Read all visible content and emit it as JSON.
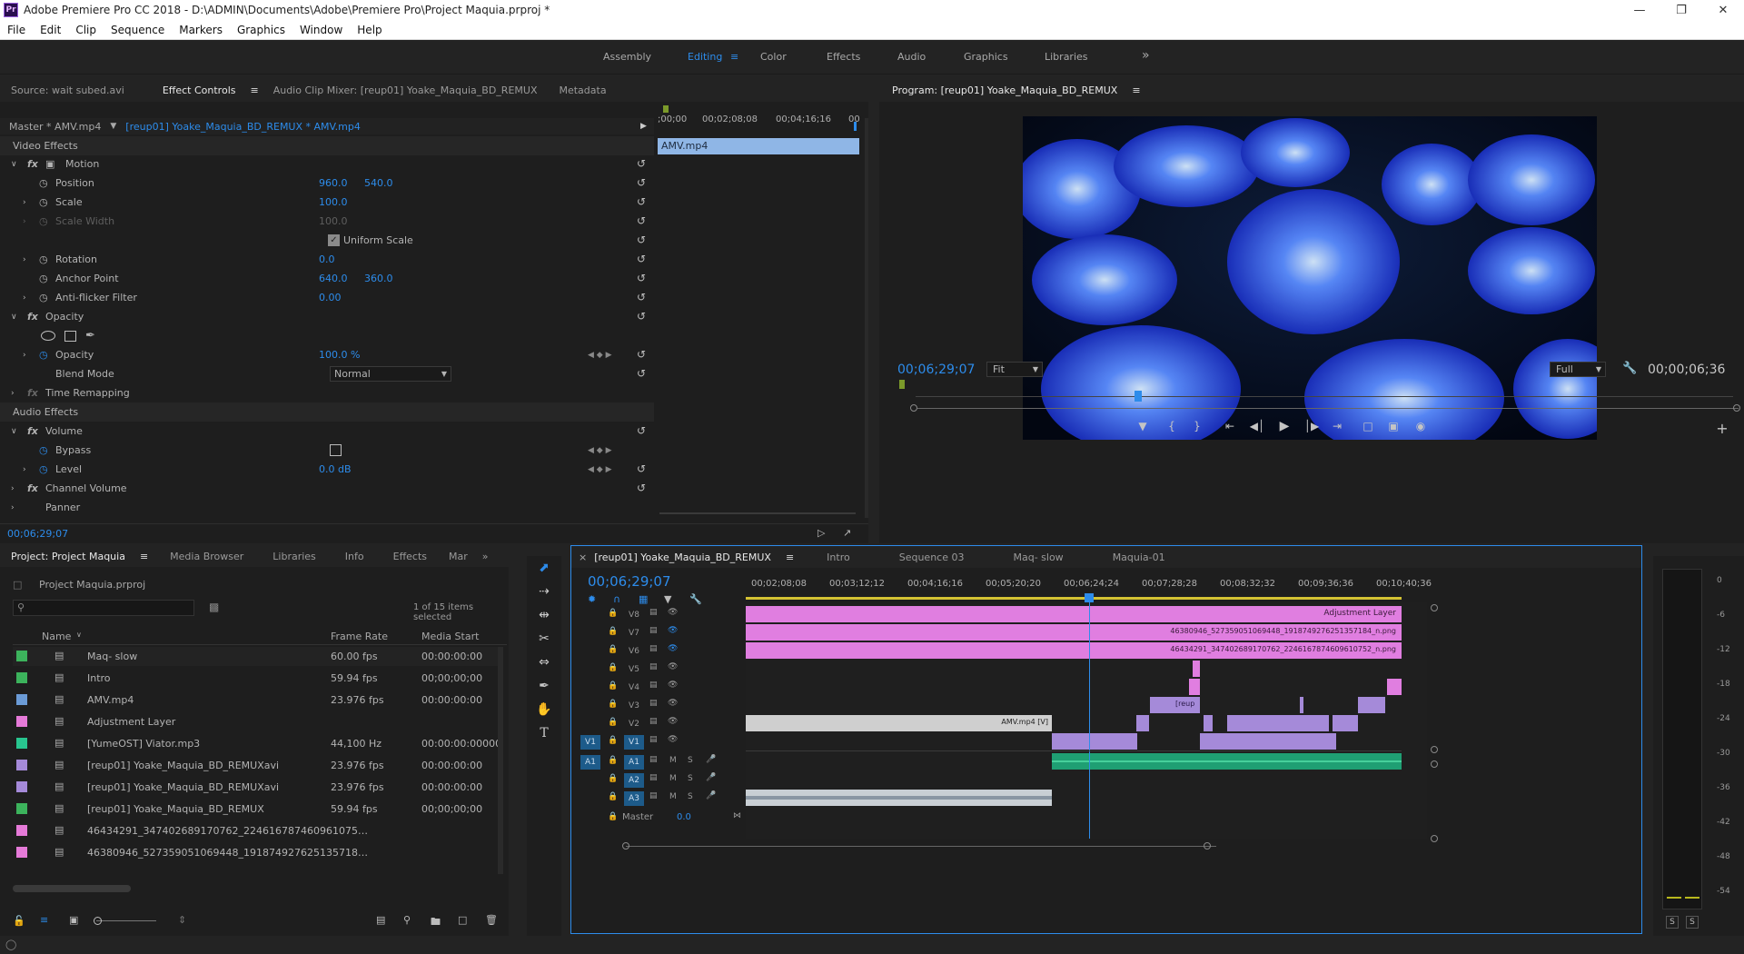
{
  "window": {
    "title": "Adobe Premiere Pro CC 2018 - D:\\ADMIN\\Documents\\Adobe\\Premiere Pro\\Project Maquia.prproj *",
    "app_badge": "Pr"
  },
  "menu": [
    "File",
    "Edit",
    "Clip",
    "Sequence",
    "Markers",
    "Graphics",
    "Window",
    "Help"
  ],
  "workspaces": {
    "items": [
      "Assembly",
      "Editing",
      "Color",
      "Effects",
      "Audio",
      "Graphics",
      "Libraries"
    ],
    "active": "Editing",
    "more": "»"
  },
  "source_panel": {
    "tabs": [
      "Source: wait subed.avi",
      "Effect Controls",
      "Audio Clip Mixer: [reup01] Yoake_Maquia_BD_REMUX",
      "Metadata"
    ],
    "master_label": "Master * AMV.mp4",
    "seq_label": "[reup01] Yoake_Maquia_BD_REMUX * AMV.mp4",
    "mini_times": [
      ";00;00",
      "00;02;08;08",
      "00;04;16;16",
      "00"
    ],
    "clip_label": "AMV.mp4",
    "video_effects": "Video Effects",
    "audio_effects": "Audio Effects",
    "motion": "Motion",
    "position": {
      "label": "Position",
      "x": "960.0",
      "y": "540.0"
    },
    "scale": {
      "label": "Scale",
      "v": "100.0"
    },
    "scale_width": {
      "label": "Scale Width",
      "v": "100.0"
    },
    "uniform_scale": "Uniform Scale",
    "rotation": {
      "label": "Rotation",
      "v": "0.0"
    },
    "anchor": {
      "label": "Anchor Point",
      "x": "640.0",
      "y": "360.0"
    },
    "antiflicker": {
      "label": "Anti-flicker Filter",
      "v": "0.00"
    },
    "opacity_group": "Opacity",
    "opacity": {
      "label": "Opacity",
      "v": "100.0 %"
    },
    "blend": {
      "label": "Blend Mode",
      "v": "Normal"
    },
    "time_remap": "Time Remapping",
    "volume": "Volume",
    "bypass": "Bypass",
    "level": {
      "label": "Level",
      "v": "0.0 dB"
    },
    "channel_volume": "Channel Volume",
    "panner": "Panner",
    "timecode": "00;06;29;07"
  },
  "program": {
    "title": "Program: [reup01] Yoake_Maquia_BD_REMUX",
    "timecode": "00;06;29;07",
    "fit": "Fit",
    "quality": "Full",
    "duration": "00;00;06;36"
  },
  "project": {
    "tabs": [
      "Project: Project Maquia",
      "Media Browser",
      "Libraries",
      "Info",
      "Effects",
      "Mar"
    ],
    "file": "Project Maquia.prproj",
    "selected": "1 of 15 items selected",
    "columns": [
      "Name",
      "Frame Rate",
      "Media Start"
    ],
    "items": [
      {
        "color": "#3cb35c",
        "name": "Maq- slow",
        "rate": "60.00 fps",
        "start": "00:00:00:00"
      },
      {
        "color": "#3cb35c",
        "name": "Intro",
        "rate": "59.94 fps",
        "start": "00;00;00;00"
      },
      {
        "color": "#6b9bd6",
        "name": "AMV.mp4",
        "rate": "23.976 fps",
        "start": "00:00:00:00"
      },
      {
        "color": "#e57ad8",
        "name": "Adjustment Layer",
        "rate": "",
        "start": ""
      },
      {
        "color": "#28c58f",
        "name": "[YumeOST] Viator.mp3",
        "rate": "44,100 Hz",
        "start": "00:00:00:00000"
      },
      {
        "color": "#a58ad9",
        "name": "[reup01] Yoake_Maquia_BD_REMUXavi",
        "rate": "23.976 fps",
        "start": "00:00:00:00"
      },
      {
        "color": "#a58ad9",
        "name": "[reup01] Yoake_Maquia_BD_REMUXavi",
        "rate": "23.976 fps",
        "start": "00:00:00:00"
      },
      {
        "color": "#3cb35c",
        "name": "[reup01] Yoake_Maquia_BD_REMUX",
        "rate": "59.94 fps",
        "start": "00;00;00;00"
      },
      {
        "color": "#e57ad8",
        "name": "46434291_347402689170762_224616787460961075…",
        "rate": "",
        "start": ""
      },
      {
        "color": "#e57ad8",
        "name": "46380946_527359051069448_191874927625135718…",
        "rate": "",
        "start": ""
      }
    ]
  },
  "timeline": {
    "tabs": [
      "[reup01] Yoake_Maquia_BD_REMUX",
      "Intro",
      "Sequence 03",
      "Maq- slow",
      "Maquia-01"
    ],
    "timecode": "00;06;29;07",
    "ruler": [
      "00;02;08;08",
      "00;03;12;12",
      "00;04;16;16",
      "00;05;20;20",
      "00;06;24;24",
      "00;07;28;28",
      "00;08;32;32",
      "00;09;36;36",
      "00;10;40;36"
    ],
    "video_tracks": [
      "V8",
      "V7",
      "V6",
      "V5",
      "V4",
      "V3",
      "V2",
      "V1"
    ],
    "audio_tracks": [
      "A1",
      "A2",
      "A3"
    ],
    "master": {
      "label": "Master",
      "v": "0.0"
    },
    "clips": {
      "adjustment": "Adjustment Layer",
      "png1": "46380946_527359051069448_1918749276251357184_n.png",
      "png2": "46434291_347402689170762_2246167874609610752_n.png",
      "amv": "AMV.mp4 [V]",
      "reup": "[reup"
    }
  },
  "meter_labels": [
    "0",
    "-6",
    "-12",
    "-18",
    "-24",
    "-30",
    "-36",
    "-42",
    "-48",
    "-54"
  ],
  "meter_solo": [
    "S",
    "S"
  ]
}
